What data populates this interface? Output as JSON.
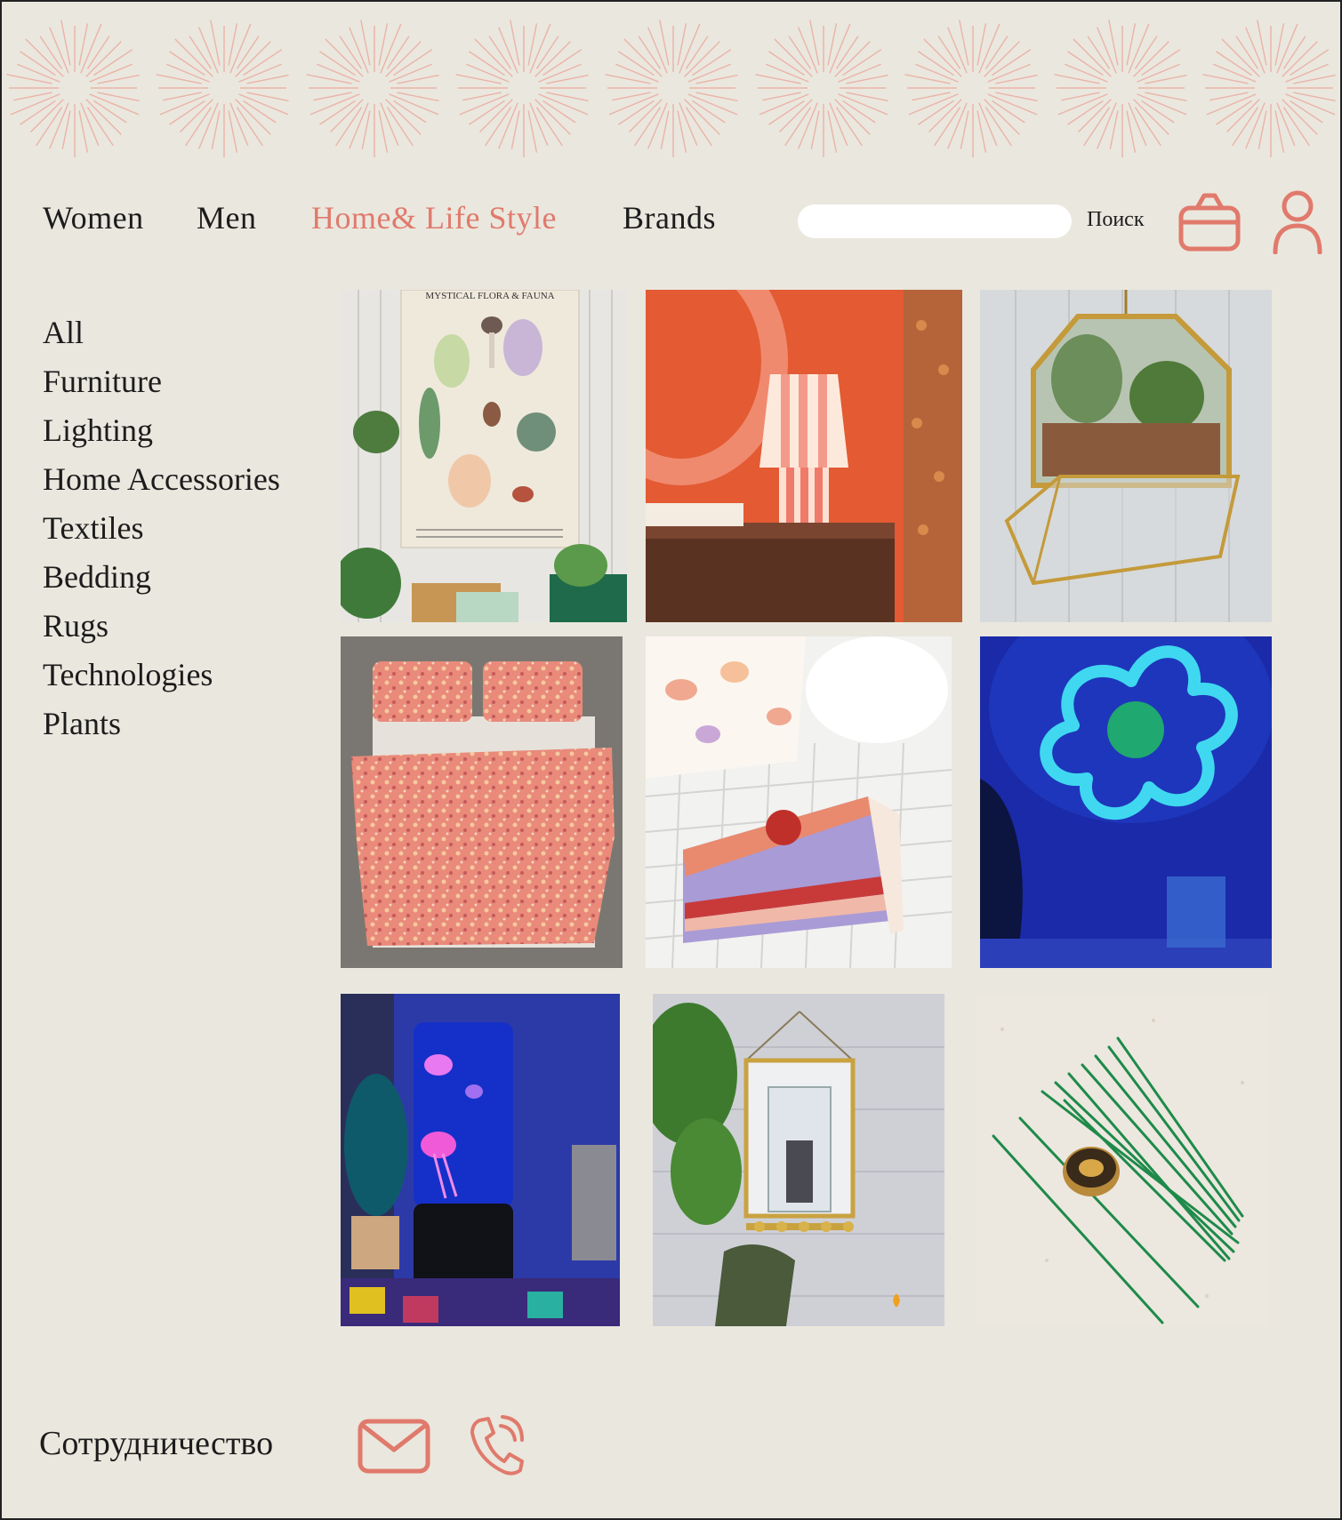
{
  "nav": {
    "women": "Women",
    "men": "Men",
    "home": "Home& Life Style",
    "brands": "Brands"
  },
  "search": {
    "placeholder": "",
    "label": "Поиск"
  },
  "icons": {
    "cart": "shopping-bag-icon",
    "profile": "user-icon",
    "mail": "mail-icon",
    "phone": "phone-icon"
  },
  "colors": {
    "accent": "#e07a6c",
    "background": "#eae7de",
    "text": "#1c1c1c"
  },
  "categories": [
    "All",
    "Furniture",
    "Lighting",
    "Home Accessories",
    "Textiles",
    "Bedding",
    "Rugs",
    "Technologies",
    "Plants"
  ],
  "products": {
    "tapestry_title": "MYSTICAL FLORA & FAUNA"
  },
  "footer": {
    "cooperation": "Сотрудничество"
  }
}
